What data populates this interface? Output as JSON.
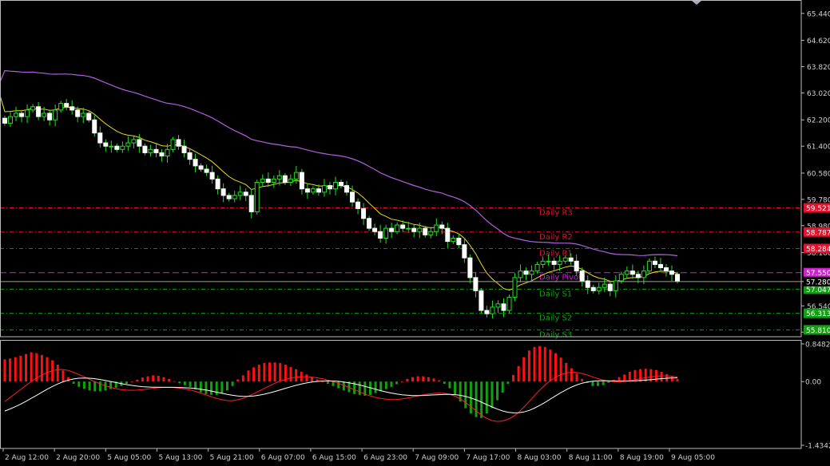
{
  "chart_data": [
    {
      "type": "candlestick",
      "title": "",
      "y_ticks": [
        "65.440",
        "64.620",
        "63.820",
        "63.020",
        "62.200",
        "61.400",
        "60.580",
        "59.780",
        "58.980",
        "58.160",
        "57.280",
        "56.540",
        "55.740"
      ],
      "ylim": [
        55.6,
        65.8
      ],
      "current_price": "57.280",
      "x_ticks": [
        "2 Aug 12:00",
        "2 Aug 20:00",
        "5 Aug 05:00",
        "5 Aug 13:00",
        "5 Aug 21:00",
        "6 Aug 07:00",
        "6 Aug 15:00",
        "6 Aug 23:00",
        "7 Aug 09:00",
        "7 Aug 17:00",
        "8 Aug 03:00",
        "8 Aug 11:00",
        "8 Aug 19:00",
        "9 Aug 05:00"
      ],
      "pivot_levels": [
        {
          "name": "Daily R3",
          "value": 59.521,
          "label": "59.521",
          "color": "#e0142e"
        },
        {
          "name": "Daily R2",
          "value": 58.787,
          "label": "58.787",
          "color": "#e0142e"
        },
        {
          "name": "Daily R1",
          "value": 58.284,
          "label": "58.284",
          "color": "#e0142e"
        },
        {
          "name": "Daily Pivot",
          "value": 57.55,
          "label": "57.550",
          "color": "#d020d0"
        },
        {
          "name": "Daily S1",
          "value": 57.047,
          "label": "57.047",
          "color": "#10a010"
        },
        {
          "name": "Daily S2",
          "value": 56.313,
          "label": "56.313",
          "color": "#10a010"
        },
        {
          "name": "Daily S3",
          "value": 55.81,
          "label": "55.810",
          "color": "#10a010"
        }
      ],
      "pivot_text_labels": [
        "Daily R3",
        "Daily R2",
        "Daily R1",
        "Daily Pivot",
        "Daily S1",
        "Daily S2",
        "Daily S3"
      ],
      "close": [
        62.1,
        62.3,
        62.4,
        62.3,
        62.5,
        62.6,
        62.3,
        62.4,
        62.2,
        62.5,
        62.7,
        62.6,
        62.5,
        62.3,
        62.4,
        62.2,
        61.8,
        61.5,
        61.4,
        61.4,
        61.3,
        61.4,
        61.5,
        61.6,
        61.4,
        61.2,
        61.3,
        61.2,
        61.1,
        61.3,
        61.6,
        61.4,
        61.2,
        61.0,
        60.8,
        60.7,
        60.6,
        60.4,
        60.1,
        59.9,
        59.8,
        59.9,
        60.0,
        59.9,
        59.4,
        60.3,
        60.4,
        60.3,
        60.4,
        60.5,
        60.3,
        60.4,
        60.6,
        60.1,
        60.0,
        60.1,
        60.0,
        60.2,
        60.1,
        60.3,
        60.2,
        60.0,
        59.7,
        59.5,
        59.2,
        58.9,
        58.8,
        58.6,
        58.9,
        58.8,
        59.0,
        58.9,
        58.9,
        58.8,
        58.9,
        58.7,
        58.8,
        59.0,
        58.9,
        58.5,
        58.6,
        58.4,
        58.0,
        57.4,
        57.0,
        56.4,
        56.3,
        56.5,
        56.6,
        56.4,
        56.8,
        57.4,
        57.6,
        57.5,
        57.6,
        57.8,
        57.9,
        57.9,
        57.8,
        57.9,
        58.0,
        57.9,
        57.6,
        57.3,
        57.1,
        57.0,
        57.1,
        57.2,
        57.0,
        57.3,
        57.5,
        57.6,
        57.5,
        57.4,
        57.6,
        57.9,
        57.8,
        57.7,
        57.6,
        57.5,
        57.3
      ],
      "macd_histogram": [
        0.5,
        0.52,
        0.55,
        0.58,
        0.62,
        0.66,
        0.64,
        0.6,
        0.55,
        0.48,
        0.38,
        0.25,
        0.1,
        -0.05,
        -0.12,
        -0.16,
        -0.2,
        -0.22,
        -0.22,
        -0.2,
        -0.17,
        -0.14,
        -0.1,
        -0.05,
        0.0,
        0.04,
        0.09,
        0.12,
        0.14,
        0.13,
        0.1,
        0.06,
        0.01,
        -0.04,
        -0.08,
        -0.12,
        -0.18,
        -0.24,
        -0.28,
        -0.3,
        -0.3,
        -0.26,
        -0.2,
        -0.1,
        0.05,
        0.14,
        0.25,
        0.32,
        0.38,
        0.42,
        0.43,
        0.43,
        0.42,
        0.38,
        0.33,
        0.28,
        0.22,
        0.16,
        0.1,
        0.05,
        0.0,
        -0.05,
        -0.1,
        -0.15,
        -0.2,
        -0.24,
        -0.28,
        -0.3,
        -0.32,
        -0.3,
        -0.26,
        -0.22,
        -0.17,
        -0.12,
        -0.06,
        0.0,
        0.06,
        0.1,
        0.12,
        0.12,
        0.1,
        0.07,
        0.03,
        -0.05,
        -0.15,
        -0.3,
        -0.45,
        -0.6,
        -0.72,
        -0.8,
        -0.82,
        -0.72,
        -0.6,
        -0.42,
        -0.25,
        -0.05,
        0.15,
        0.35,
        0.55,
        0.7,
        0.78,
        0.8,
        0.78,
        0.72,
        0.64,
        0.54,
        0.42,
        0.3,
        0.18,
        0.06,
        -0.03,
        -0.1,
        -0.1,
        -0.08,
        -0.03,
        0.04,
        0.1,
        0.16,
        0.22,
        0.26,
        0.28,
        0.29,
        0.28,
        0.26,
        0.22,
        0.17,
        0.12,
        0.06
      ],
      "macd_ticks": [
        "0.84822",
        "0.00",
        "-1.4342"
      ],
      "macd_ylim": [
        -1.4342,
        0.84822
      ]
    }
  ]
}
